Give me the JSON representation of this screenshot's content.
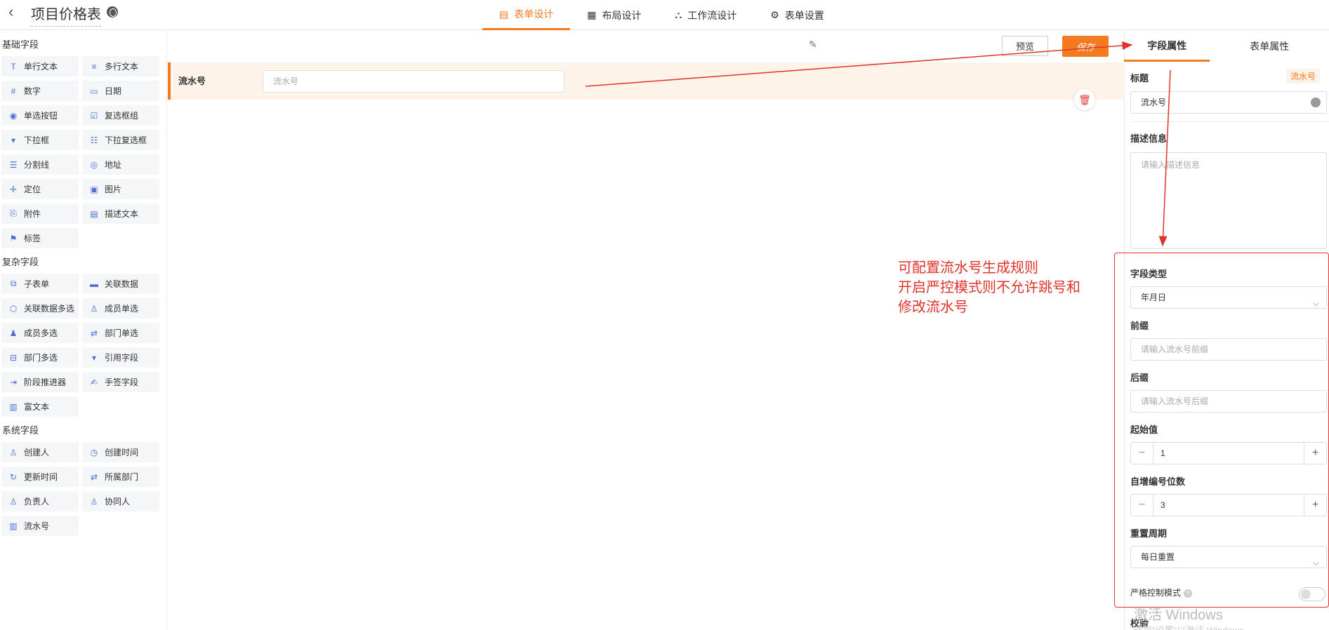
{
  "header": {
    "back_icon": "chevron-left-icon",
    "title": "项目价格表",
    "tabs": [
      {
        "label": "表单设计",
        "icon": "form-icon"
      },
      {
        "label": "布局设计",
        "icon": "layout-icon"
      },
      {
        "label": "工作流设计",
        "icon": "workflow-icon"
      },
      {
        "label": "表单设置",
        "icon": "gear-icon"
      }
    ]
  },
  "palette": {
    "basic_title": "基础字段",
    "basic": [
      "单行文本",
      "多行文本",
      "数字",
      "日期",
      "单选按钮",
      "复选框组",
      "下拉框",
      "下拉复选框",
      "分割线",
      "地址",
      "定位",
      "图片",
      "附件",
      "描述文本",
      "标签"
    ],
    "complex_title": "复杂字段",
    "complex": [
      "子表单",
      "关联数据",
      "关联数据多选",
      "成员单选",
      "成员多选",
      "部门单选",
      "部门多选",
      "引用字段",
      "阶段推进器",
      "手签字段",
      "富文本"
    ],
    "system_title": "系统字段",
    "system": [
      "创建人",
      "创建时间",
      "更新时间",
      "所属部门",
      "负责人",
      "协同人",
      "流水号"
    ]
  },
  "canvas": {
    "preview_label": "预览",
    "save_label": "保存",
    "field_label": "流水号",
    "field_placeholder": "流水号"
  },
  "annotation": {
    "line1": "可配置流水号生成规则",
    "line2": "开启严控模式则不允许跳号和",
    "line3": "修改流水号",
    "color": "#e1322b"
  },
  "panel": {
    "tab_field": "字段属性",
    "tab_form": "表单属性",
    "title_label": "标题",
    "type_tag": "流水号",
    "title_value": "流水号",
    "desc_label": "描述信息",
    "desc_placeholder": "请输入描述信息",
    "field_type_label": "字段类型",
    "field_type_value": "年月日",
    "prefix_label": "前缀",
    "prefix_placeholder": "请输入流水号前缀",
    "suffix_label": "后缀",
    "suffix_placeholder": "请输入流水号后缀",
    "start_label": "起始值",
    "start_value": "1",
    "digits_label": "自增编号位数",
    "digits_value": "3",
    "reset_label": "重置周期",
    "reset_value": "每日重置",
    "strict_label": "严格控制模式",
    "strict_enabled": false,
    "validate_label": "校验"
  },
  "watermark": {
    "line1": "激活 Windows",
    "line2": "转到\"设置\"以激活 Windows。"
  },
  "accent_color": "#f47a1f"
}
